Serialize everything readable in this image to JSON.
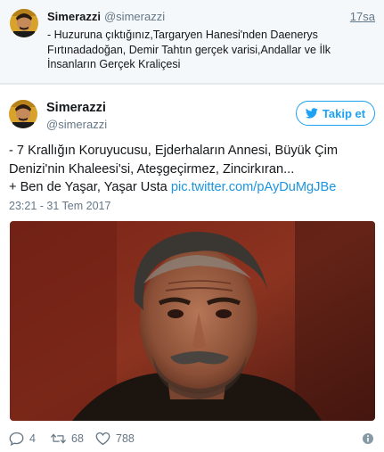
{
  "context_tweet": {
    "name": "Simerazzi",
    "handle": "@simerazzi",
    "time_number": "17",
    "time_unit": "sa",
    "text": "- Huzuruna çıktığınız,Targaryen Hanesi'nden Daenerys Fırtınadadoğan, Demir Tahtın gerçek varisi,Andallar ve İlk İnsanların Gerçek Kraliçesi"
  },
  "tweet": {
    "name": "Simerazzi",
    "handle": "@simerazzi",
    "follow_label": "Takip et",
    "text_line1": "- 7 Krallığın Koruyucusu, Ejderhaların Annesi, Büyük Çim",
    "text_line2": "Denizi'nin Khaleesi'si, Ateşgeçirmez, Zincirkıran...",
    "text_line3": "+ Ben de Yaşar, Yaşar Usta ",
    "link_text": "pic.twitter.com/pAyDuMgJBe",
    "date": "23:21 - 31 Tem 2017"
  },
  "actions": {
    "replies": "4",
    "retweets": "68",
    "likes": "788"
  },
  "colors": {
    "accent": "#1da1f2",
    "link": "#1b95e0",
    "muted": "#657786",
    "context_bg": "#f5f8fa"
  },
  "icons": {
    "twitter_bird": "twitter-bird-icon",
    "reply": "reply-icon",
    "retweet": "retweet-icon",
    "like": "heart-icon",
    "info": "info-icon"
  }
}
